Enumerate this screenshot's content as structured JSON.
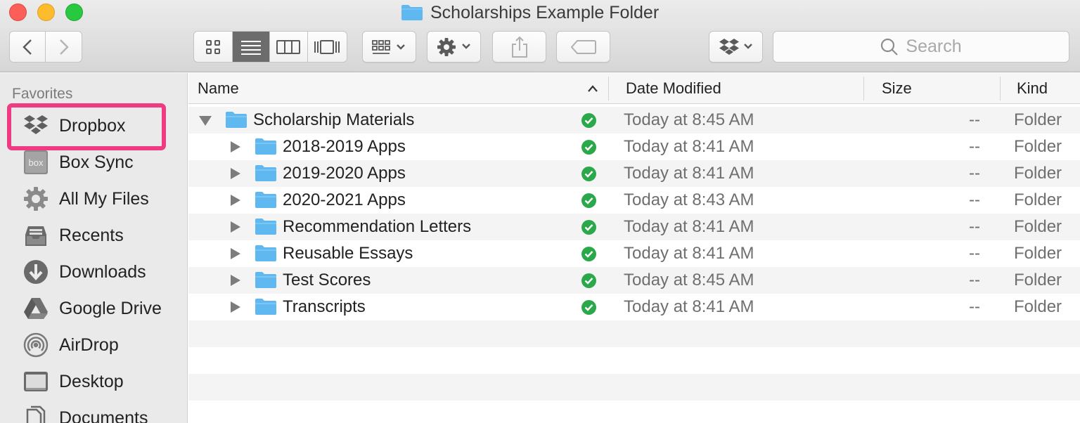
{
  "window": {
    "title": "Scholarships Example Folder"
  },
  "toolbar": {
    "search_placeholder": "Search"
  },
  "sidebar": {
    "header": "Favorites",
    "items": [
      {
        "label": "Dropbox",
        "icon": "dropbox-icon"
      },
      {
        "label": "Box Sync",
        "icon": "box-icon"
      },
      {
        "label": "All My Files",
        "icon": "all-files-icon"
      },
      {
        "label": "Recents",
        "icon": "recents-icon"
      },
      {
        "label": "Downloads",
        "icon": "downloads-icon"
      },
      {
        "label": "Google Drive",
        "icon": "google-drive-icon"
      },
      {
        "label": "AirDrop",
        "icon": "airdrop-icon"
      },
      {
        "label": "Desktop",
        "icon": "desktop-icon"
      },
      {
        "label": "Documents",
        "icon": "documents-icon"
      }
    ],
    "highlighted": "Dropbox",
    "highlight_color": "#ef3b82"
  },
  "columns": {
    "name": "Name",
    "date": "Date Modified",
    "size": "Size",
    "kind": "Kind"
  },
  "rows": [
    {
      "name": "Scholarship Materials",
      "date": "Today at 8:45 AM",
      "size": "--",
      "kind": "Folder",
      "expanded": true
    },
    {
      "name": "2018-2019 Apps",
      "date": "Today at 8:41 AM",
      "size": "--",
      "kind": "Folder"
    },
    {
      "name": "2019-2020 Apps",
      "date": "Today at 8:41 AM",
      "size": "--",
      "kind": "Folder"
    },
    {
      "name": "2020-2021 Apps",
      "date": "Today at 8:43 AM",
      "size": "--",
      "kind": "Folder"
    },
    {
      "name": "Recommendation Letters",
      "date": "Today at 8:41 AM",
      "size": "--",
      "kind": "Folder"
    },
    {
      "name": "Reusable Essays",
      "date": "Today at 8:41 AM",
      "size": "--",
      "kind": "Folder"
    },
    {
      "name": "Test Scores",
      "date": "Today at 8:45 AM",
      "size": "--",
      "kind": "Folder"
    },
    {
      "name": "Transcripts",
      "date": "Today at 8:41 AM",
      "size": "--",
      "kind": "Folder"
    }
  ],
  "colors": {
    "folder": "#5fb8f0",
    "sync_ok": "#2ba94a",
    "active_segment": "#6c6c6c"
  }
}
